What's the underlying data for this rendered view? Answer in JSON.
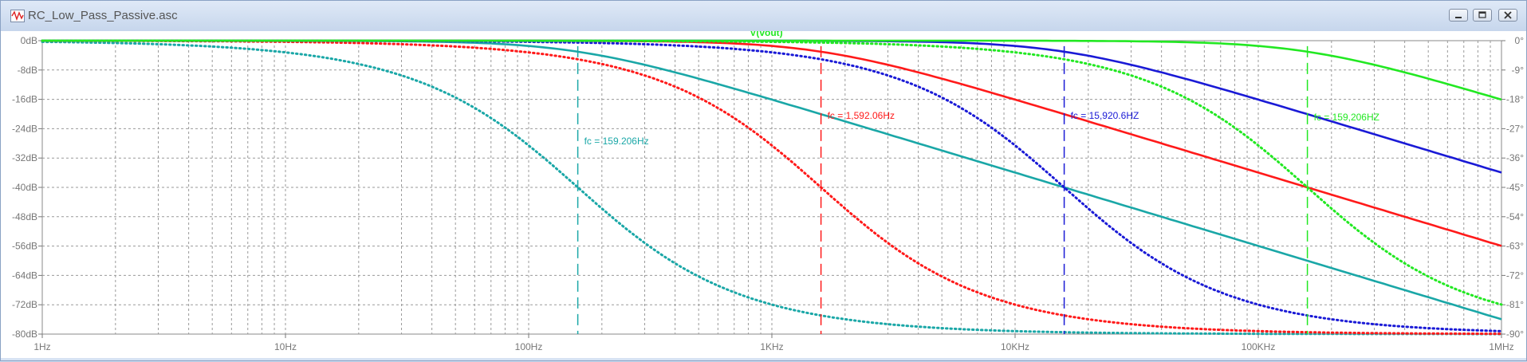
{
  "window": {
    "title": "RC_Low_Pass_Passive.asc"
  },
  "chart_data": {
    "type": "line",
    "title": "V(vout)",
    "x_scale": "log",
    "xlim": [
      1,
      1000000
    ],
    "x_ticks": [
      {
        "value": 1,
        "label": "1Hz"
      },
      {
        "value": 10,
        "label": "10Hz"
      },
      {
        "value": 100,
        "label": "100Hz"
      },
      {
        "value": 1000,
        "label": "1KHz"
      },
      {
        "value": 10000,
        "label": "10KHz"
      },
      {
        "value": 100000,
        "label": "100KHz"
      },
      {
        "value": 1000000,
        "label": "1MHz"
      }
    ],
    "ylim": [
      -80,
      0
    ],
    "y_ticks": [
      {
        "value": 0,
        "label": "0dB"
      },
      {
        "value": -8,
        "label": "-8dB"
      },
      {
        "value": -16,
        "label": "-16dB"
      },
      {
        "value": -24,
        "label": "-24dB"
      },
      {
        "value": -32,
        "label": "-32dB"
      },
      {
        "value": -40,
        "label": "-40dB"
      },
      {
        "value": -48,
        "label": "-48dB"
      },
      {
        "value": -56,
        "label": "-56dB"
      },
      {
        "value": -64,
        "label": "-64dB"
      },
      {
        "value": -72,
        "label": "-72dB"
      },
      {
        "value": -80,
        "label": "-80dB"
      }
    ],
    "y2lim": [
      -90,
      0
    ],
    "y2_ticks": [
      {
        "value": 0,
        "label": "0°"
      },
      {
        "value": -9,
        "label": "-9°"
      },
      {
        "value": -18,
        "label": "-18°"
      },
      {
        "value": -27,
        "label": "-27°"
      },
      {
        "value": -36,
        "label": "-36°"
      },
      {
        "value": -45,
        "label": "-45°"
      },
      {
        "value": -54,
        "label": "-54°"
      },
      {
        "value": -63,
        "label": "-63°"
      },
      {
        "value": -72,
        "label": "-72°"
      },
      {
        "value": -81,
        "label": "-81°"
      },
      {
        "value": -90,
        "label": "-90°"
      }
    ],
    "grid": true,
    "series": [
      {
        "fc": 159.206,
        "color": "#1aa7a7",
        "label": "fc = 159.206Hz"
      },
      {
        "fc": 1592.06,
        "color": "#ff1a1a",
        "label": "fc = 1,592.06Hz"
      },
      {
        "fc": 15920.6,
        "color": "#1a1ad6",
        "label": "fc = 15,920.6HZ"
      },
      {
        "fc": 159206,
        "color": "#22e822",
        "label": "fc = 159,206HZ"
      }
    ]
  }
}
